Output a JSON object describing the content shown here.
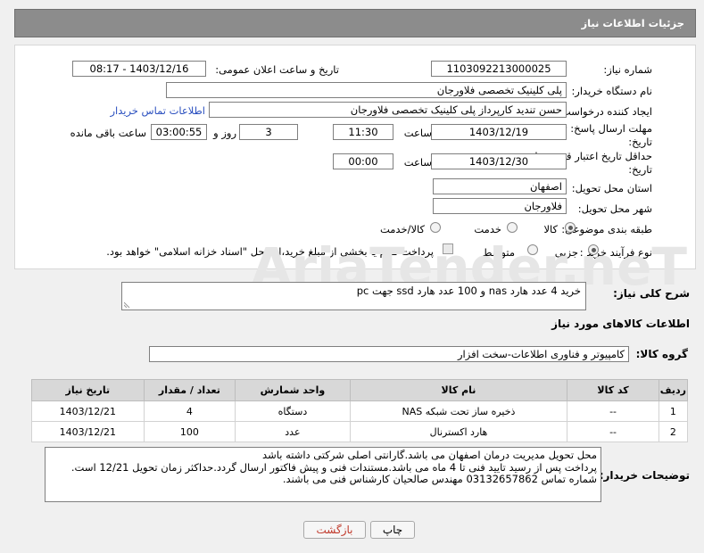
{
  "header": {
    "title": "جزئیات اطلاعات نیاز"
  },
  "form": {
    "need_number": {
      "label": "شماره نیاز:",
      "value": "1103092213000025"
    },
    "announce_datetime": {
      "label": "تاریخ و ساعت اعلان عمومی:",
      "value": "1403/12/16 - 08:17"
    },
    "buyer_org": {
      "label": "نام دستگاه خریدار:",
      "value": "پلی کلینیک تخصصی فلاورجان"
    },
    "creator": {
      "label": "ایجاد کننده درخواست:",
      "value": "حسن تندید کارپرداز پلی کلینیک تخصصی فلاورجان",
      "contact_link": "اطلاعات تماس خریدار"
    },
    "reply_deadline": {
      "label_line1": "مهلت ارسال پاسخ: تا",
      "label_line2": "تاریخ:",
      "date": "1403/12/19",
      "time_label": "ساعت",
      "time": "11:30",
      "days": "3",
      "days_label": "روز و",
      "remaining": "03:00:55",
      "remaining_label": "ساعت باقی مانده"
    },
    "price_validity": {
      "label_line1": "حداقل تاریخ اعتبار قیمت: تا",
      "label_line2": "تاریخ:",
      "date": "1403/12/30",
      "time_label": "ساعت",
      "time": "00:00"
    },
    "province": {
      "label": "استان محل تحویل:",
      "value": "اصفهان"
    },
    "city": {
      "label": "شهر محل تحویل:",
      "value": "فلاورجان"
    },
    "category": {
      "label": "طبقه بندی موضوعی:",
      "options": [
        "کالا",
        "خدمت",
        "کالا/خدمت"
      ],
      "selected": "کالا"
    },
    "purchase_type": {
      "label": "نوع فرآیند خرید :",
      "options": [
        "جزیی",
        "متوسط"
      ],
      "selected": "جزیی",
      "payment_note": "پرداخت تمام یا بخشی از مبلغ خرید،از محل \"اسناد خزانه اسلامی\" خواهد بود."
    }
  },
  "general_description": {
    "label": "شرح کلی نیاز:",
    "value": "خرید 4 عدد هارد nas و 100 عدد هارد ssd جهت pc"
  },
  "goods_info": {
    "title": "اطلاعات کالاهای مورد نیاز",
    "group_label": "گروه کالا:",
    "group_value": "کامپیوتر و فناوری اطلاعات-سخت افزار"
  },
  "table": {
    "headers": [
      "ردیف",
      "کد کالا",
      "نام کالا",
      "واحد شمارش",
      "تعداد / مقدار",
      "تاریخ نیاز"
    ],
    "rows": [
      [
        "1",
        "--",
        "ذخیره ساز تحت شبکه NAS",
        "دستگاه",
        "4",
        "1403/12/21"
      ],
      [
        "2",
        "--",
        "هارد اکسترنال",
        "عدد",
        "100",
        "1403/12/21"
      ]
    ]
  },
  "buyer_notes": {
    "label": "توضیحات خریدار:",
    "lines": [
      "محل تحویل مدیریت درمان  اصفهان می باشد.گارانتی اصلی شرکتی داشته باشد",
      "پرداخت پس از رسید تایید فنی تا 4 ماه می باشد.مستندات فنی  و پیش فاکتور ارسال گردد.حداکثر زمان تحویل 12/21 است.",
      "شماره تماس 03132657862 مهندس صالحیان کارشناس فنی می باشند."
    ]
  },
  "buttons": {
    "print": "چاپ",
    "back": "بازگشت"
  },
  "watermark": {
    "text": "AriaTender.neT"
  },
  "colors": {
    "header_bg": "#8c8c8c",
    "link": "#2a4fbf",
    "back_button_text": "#c0392b",
    "watermark": "#e6e6e6"
  }
}
